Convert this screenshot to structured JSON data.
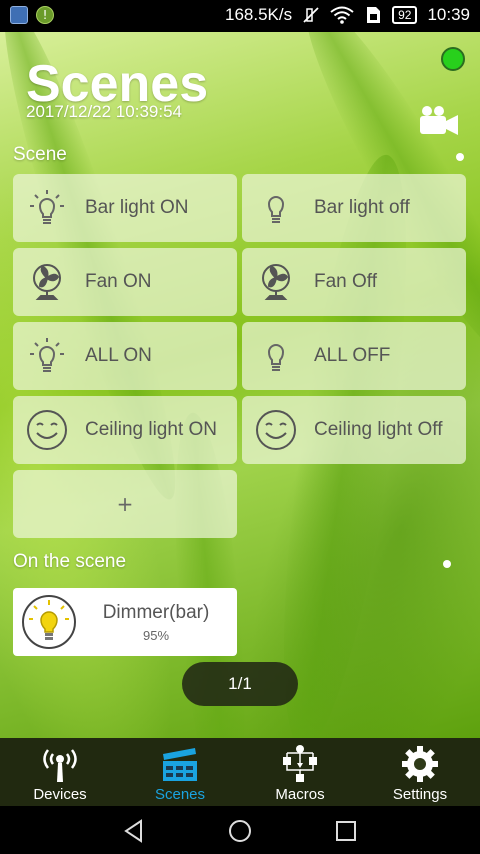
{
  "status_bar": {
    "net_speed": "168.5K/s",
    "battery": "92",
    "time": "10:39"
  },
  "header": {
    "title": "Scenes",
    "timestamp": "2017/12/22 10:39:54",
    "status_color": "#28d01c",
    "camera_icon": "video-camera-icon"
  },
  "scene_section": {
    "label": "Scene",
    "scenes": [
      {
        "label": "Bar light ON",
        "icon": "lightbulb-on-icon"
      },
      {
        "label": "Bar light off",
        "icon": "lightbulb-off-icon"
      },
      {
        "label": "Fan ON",
        "icon": "fan-icon"
      },
      {
        "label": "Fan Off",
        "icon": "fan-icon"
      },
      {
        "label": "ALL ON",
        "icon": "lightbulb-on-icon"
      },
      {
        "label": "ALL OFF",
        "icon": "lightbulb-off-icon"
      },
      {
        "label": "Ceiling light ON",
        "icon": "smiley-icon"
      },
      {
        "label": "Ceiling light Off",
        "icon": "smiley-icon"
      }
    ],
    "add_label": "+"
  },
  "on_scene_section": {
    "label": "On the scene",
    "device": {
      "name": "Dimmer(bar)",
      "value": "95%",
      "icon": "lightbulb-lit-icon"
    }
  },
  "pagination": {
    "text": "1/1"
  },
  "tabs": [
    {
      "label": "Devices",
      "icon": "antenna-icon",
      "active": false
    },
    {
      "label": "Scenes",
      "icon": "clapperboard-icon",
      "active": true
    },
    {
      "label": "Macros",
      "icon": "macro-flow-icon",
      "active": false
    },
    {
      "label": "Settings",
      "icon": "gear-icon",
      "active": false
    }
  ],
  "colors": {
    "accent": "#1aa3e0",
    "tile_bg": "#ebf5d7",
    "text_gray": "#555555"
  }
}
